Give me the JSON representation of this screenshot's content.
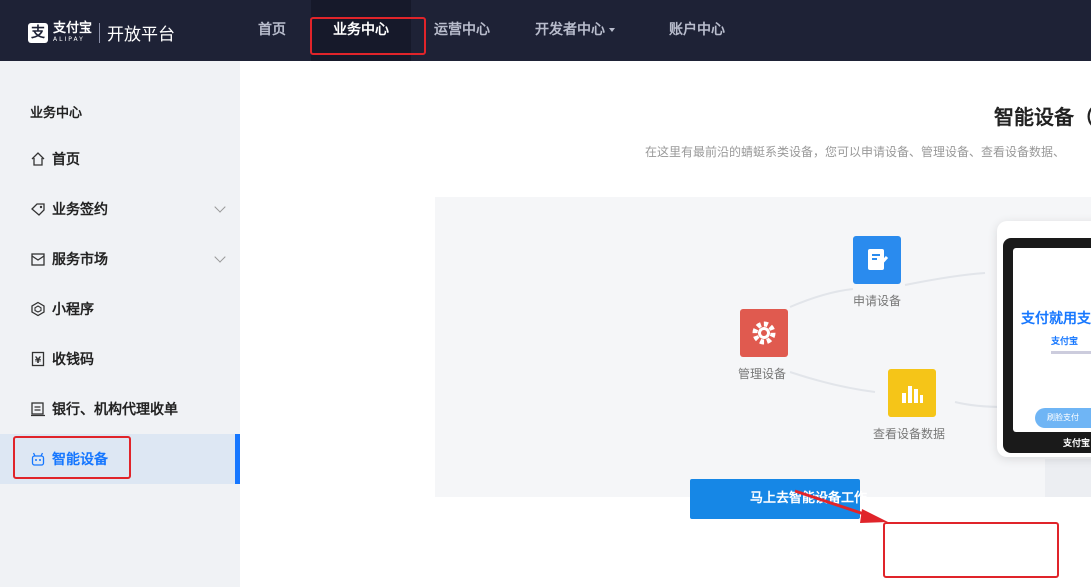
{
  "header": {
    "brand_cn": "支付宝",
    "brand_en": "ALIPAY",
    "platform": "开放平台",
    "nav": [
      {
        "label": "首页"
      },
      {
        "label": "业务中心"
      },
      {
        "label": "运营中心"
      },
      {
        "label": "开发者中心"
      },
      {
        "label": "账户中心"
      }
    ]
  },
  "sidebar": {
    "title": "业务中心",
    "items": [
      {
        "label": "首页",
        "icon": "home-icon"
      },
      {
        "label": "业务签约",
        "icon": "contract-icon"
      },
      {
        "label": "服务市场",
        "icon": "market-icon"
      },
      {
        "label": "小程序",
        "icon": "miniapp-icon"
      },
      {
        "label": "收钱码",
        "icon": "yuan-code-icon"
      },
      {
        "label": "银行、机构代理收单",
        "icon": "bank-icon"
      },
      {
        "label": "智能设备",
        "icon": "robot-icon"
      }
    ]
  },
  "main": {
    "title": "智能设备（",
    "description": "在这里有最前沿的蜻蜓系类设备，您可以申请设备、管理设备、查看设备数据、",
    "illustration": {
      "apply_label": "申请设备",
      "manage_label": "管理设备",
      "data_label": "查看设备数据",
      "device_headline": "支付就用支",
      "device_logo": "支付宝",
      "device_button": "刷脸支付",
      "device_footer": "支付宝"
    },
    "cta_label": "马上去智能设备工作"
  },
  "colors": {
    "topbar": "#1e2236",
    "accent": "#1677ff",
    "cta": "#1687e6",
    "annotation": "#e0242a",
    "apply_icon": "#2a8bee",
    "manage_icon": "#e05a4f",
    "data_icon": "#f5c518"
  }
}
